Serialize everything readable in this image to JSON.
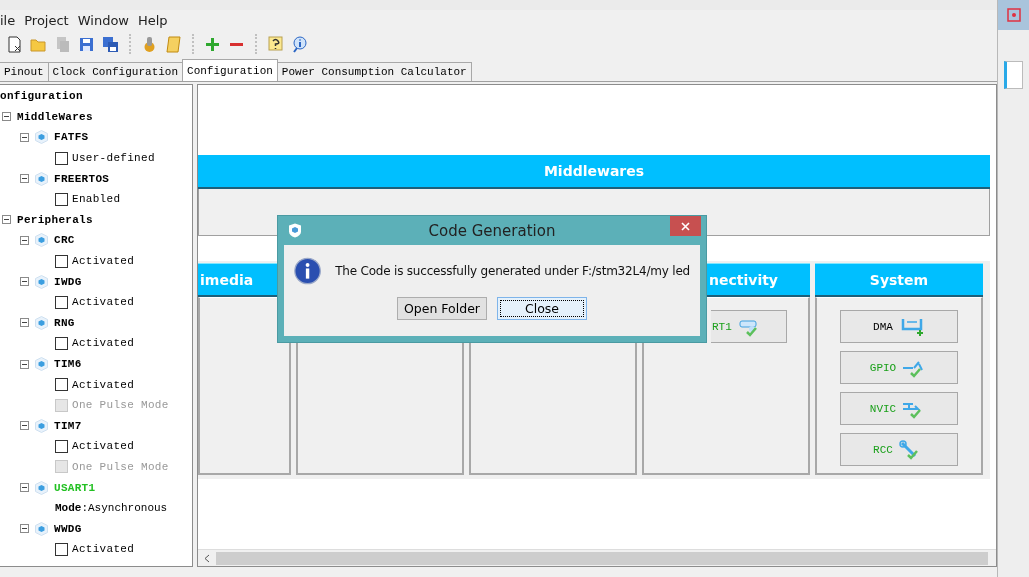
{
  "menu": [
    "ile",
    "Project",
    "Window",
    "Help"
  ],
  "toolbar": [
    {
      "kind": "new"
    },
    {
      "kind": "open"
    },
    {
      "kind": "copy",
      "disabled": true
    },
    {
      "kind": "save"
    },
    {
      "kind": "saveall"
    },
    {
      "kind": "sep"
    },
    {
      "kind": "generate"
    },
    {
      "kind": "script"
    },
    {
      "kind": "sep"
    },
    {
      "kind": "add"
    },
    {
      "kind": "remove"
    },
    {
      "kind": "sep"
    },
    {
      "kind": "help"
    },
    {
      "kind": "info"
    }
  ],
  "tabs": [
    {
      "label": "Pinout",
      "selected": false
    },
    {
      "label": "Clock Configuration",
      "selected": false
    },
    {
      "label": "Configuration",
      "selected": true
    },
    {
      "label": "Power Consumption Calculator",
      "selected": false
    }
  ],
  "tree": [
    {
      "kind": "root",
      "label": "onfiguration",
      "children": [
        {
          "kind": "group",
          "label": "MiddleWares",
          "children": [
            {
              "kind": "module",
              "label": "FATFS",
              "configured": false,
              "children": [
                {
                  "kind": "checkbox",
                  "label": "User-defined",
                  "checked": false,
                  "disabled": false
                }
              ]
            },
            {
              "kind": "module",
              "label": "FREERTOS",
              "configured": false,
              "children": [
                {
                  "kind": "checkbox",
                  "label": "Enabled",
                  "checked": false,
                  "disabled": false
                }
              ]
            }
          ]
        },
        {
          "kind": "group",
          "label": "Peripherals",
          "children": [
            {
              "kind": "module",
              "label": "CRC",
              "configured": false,
              "children": [
                {
                  "kind": "checkbox",
                  "label": "Activated",
                  "checked": false,
                  "disabled": false
                }
              ]
            },
            {
              "kind": "module",
              "label": "IWDG",
              "configured": false,
              "children": [
                {
                  "kind": "checkbox",
                  "label": "Activated",
                  "checked": false,
                  "disabled": false
                }
              ]
            },
            {
              "kind": "module",
              "label": "RNG",
              "configured": false,
              "children": [
                {
                  "kind": "checkbox",
                  "label": "Activated",
                  "checked": false,
                  "disabled": false
                }
              ]
            },
            {
              "kind": "module",
              "label": "TIM6",
              "configured": false,
              "children": [
                {
                  "kind": "checkbox",
                  "label": "Activated",
                  "checked": false,
                  "disabled": false
                },
                {
                  "kind": "checkbox",
                  "label": "One Pulse Mode",
                  "checked": false,
                  "disabled": true
                }
              ]
            },
            {
              "kind": "module",
              "label": "TIM7",
              "configured": false,
              "children": [
                {
                  "kind": "checkbox",
                  "label": "Activated",
                  "checked": false,
                  "disabled": false
                },
                {
                  "kind": "checkbox",
                  "label": "One Pulse Mode",
                  "checked": false,
                  "disabled": true
                }
              ]
            },
            {
              "kind": "module",
              "label": "USART1",
              "configured": true,
              "children": [
                {
                  "kind": "setting",
                  "label": "**Mode**:Asynchronous"
                }
              ]
            },
            {
              "kind": "module",
              "label": "WWDG",
              "configured": false,
              "children": [
                {
                  "kind": "checkbox",
                  "label": "Activated",
                  "checked": false,
                  "disabled": false
                }
              ]
            }
          ]
        }
      ]
    }
  ],
  "middlewares": {
    "title": "Middlewares"
  },
  "categories": [
    {
      "kind": "panel",
      "title": "imedia"
    },
    {
      "kind": "panel"
    },
    {
      "kind": "panel"
    },
    {
      "kind": "panel",
      "title": "nectivity",
      "buttons": [
        {
          "label": "RT1",
          "kind": "serial",
          "configured": true
        }
      ]
    },
    {
      "kind": "panel",
      "title": "System",
      "buttons": [
        {
          "label": "DMA",
          "kind": "dma",
          "configured": false
        },
        {
          "label": "GPIO",
          "kind": "gpio",
          "configured": true
        },
        {
          "label": "NVIC",
          "kind": "nvic",
          "configured": true
        },
        {
          "label": "RCC",
          "kind": "rcc",
          "configured": true
        }
      ]
    }
  ],
  "dialog": {
    "title": "Code Generation",
    "message": "The Code is successfully generated under F:/stm32L4/my led",
    "buttons": [
      {
        "label": "Open Folder",
        "selected": false
      },
      {
        "label": "Close",
        "selected": true
      }
    ]
  }
}
